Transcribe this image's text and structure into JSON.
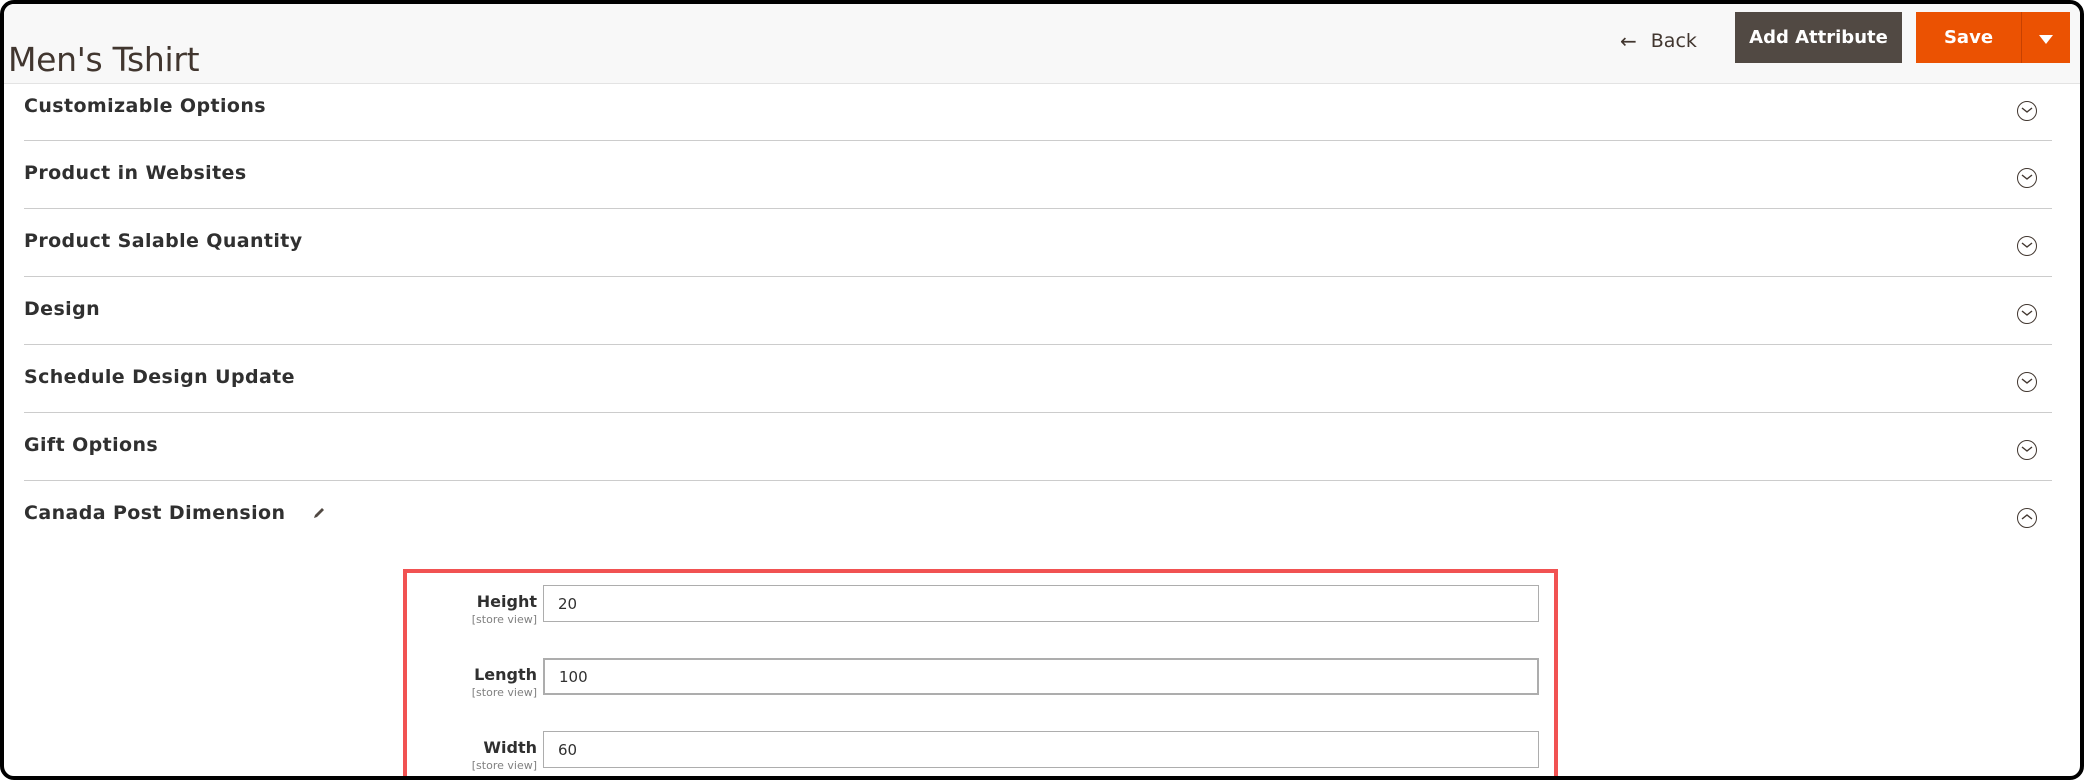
{
  "header": {
    "title": "Men's Tshirt",
    "back_label": "Back",
    "back_icon": "arrow-left-icon",
    "add_attribute_label": "Add Attribute",
    "save_label": "Save",
    "save_dropdown_icon": "caret-down-icon"
  },
  "colors": {
    "primary": "#eb5202",
    "secondary": "#514943",
    "highlight_border": "#f15252"
  },
  "sections": [
    {
      "title": "Customizable Options",
      "state": "collapsed"
    },
    {
      "title": "Product in Websites",
      "state": "collapsed"
    },
    {
      "title": "Product Salable Quantity",
      "state": "collapsed"
    },
    {
      "title": "Design",
      "state": "collapsed"
    },
    {
      "title": "Schedule Design Update",
      "state": "collapsed"
    },
    {
      "title": "Gift Options",
      "state": "collapsed"
    },
    {
      "title": "Canada Post Dimension",
      "state": "expanded",
      "edit_icon": "pencil-icon"
    }
  ],
  "dimension_fields": [
    {
      "label": "Height",
      "scope": "[store view]",
      "value": "20"
    },
    {
      "label": "Length",
      "scope": "[store view]",
      "value": "100"
    },
    {
      "label": "Width",
      "scope": "[store view]",
      "value": "60"
    }
  ]
}
